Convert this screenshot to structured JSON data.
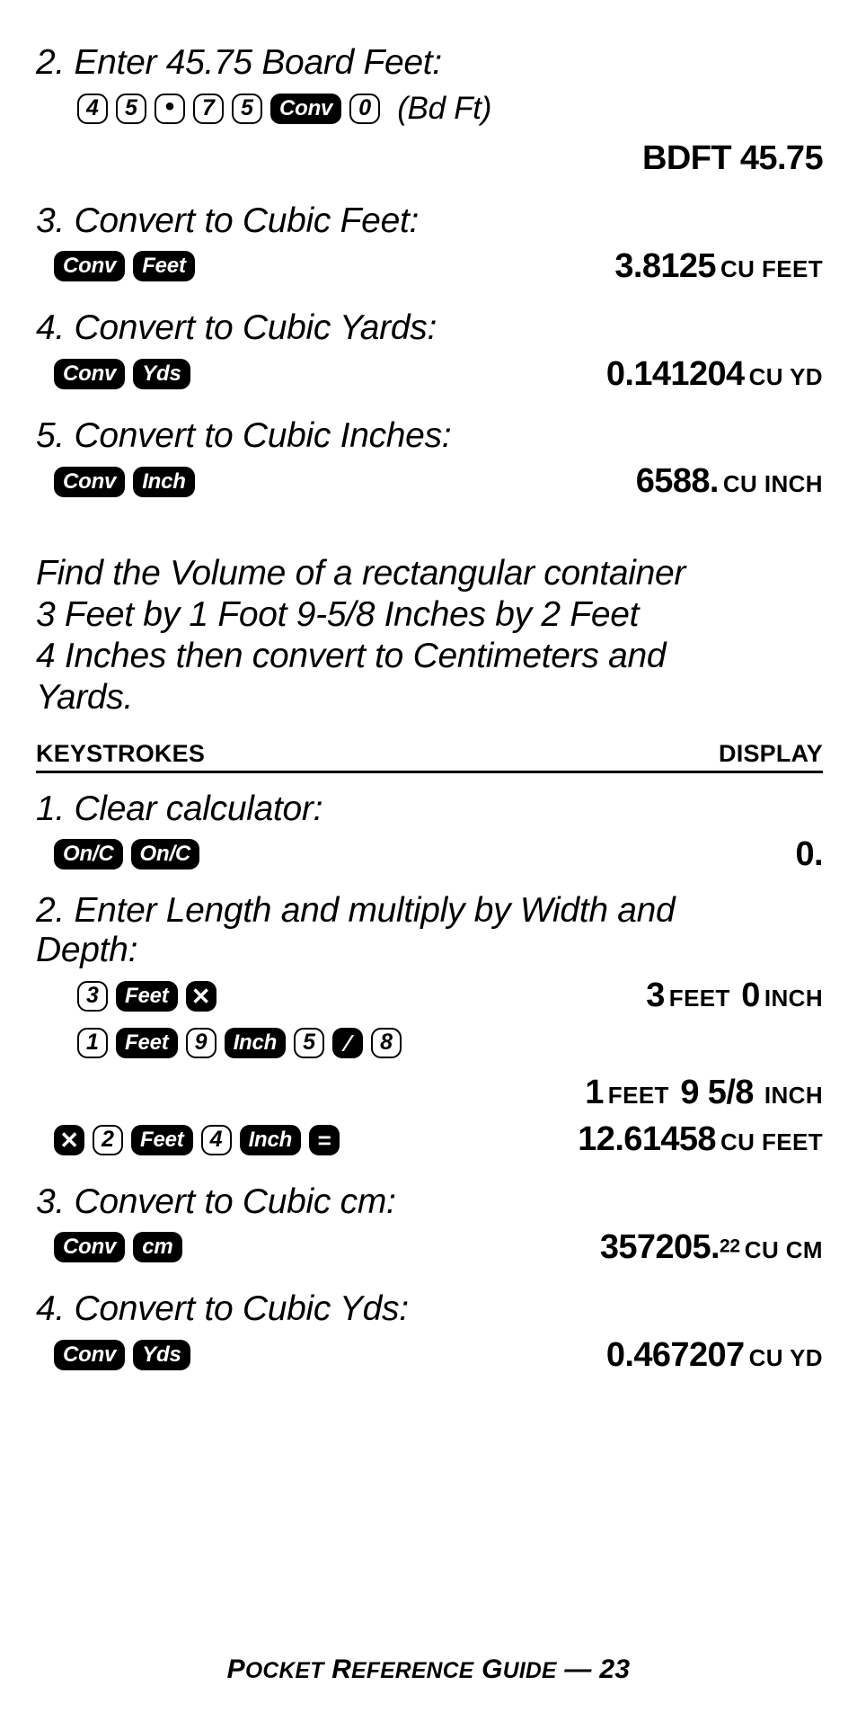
{
  "page": {
    "footer_prefix": "Pocket Reference Guide",
    "footer_dash": "—",
    "footer_page": "23"
  },
  "example_one": {
    "steps": [
      {
        "title": "2. Enter 45.75 Board Feet:",
        "keys": [
          {
            "type": "num",
            "label": "4"
          },
          {
            "type": "num",
            "label": "5"
          },
          {
            "type": "dot",
            "label": "•"
          },
          {
            "type": "num",
            "label": "7"
          },
          {
            "type": "num",
            "label": "5"
          },
          {
            "type": "fn",
            "label": "Conv"
          },
          {
            "type": "num",
            "label": "0"
          }
        ],
        "key_note": "(Bd Ft)",
        "display_value": "BDFT 45.75",
        "display_unit": ""
      },
      {
        "title": "3. Convert to Cubic Feet:",
        "keys": [
          {
            "type": "fn",
            "label": "Conv"
          },
          {
            "type": "fn",
            "label": "Feet"
          }
        ],
        "key_note": "",
        "display_value": "3.8125",
        "display_unit": "CU FEET"
      },
      {
        "title": "4. Convert to Cubic Yards:",
        "keys": [
          {
            "type": "fn",
            "label": "Conv"
          },
          {
            "type": "fn",
            "label": "Yds"
          }
        ],
        "key_note": "",
        "display_value": "0.141204",
        "display_unit": "CU YD"
      },
      {
        "title": "5. Convert to Cubic Inches:",
        "keys": [
          {
            "type": "fn",
            "label": "Conv"
          },
          {
            "type": "fn",
            "label": "Inch"
          }
        ],
        "key_note": "",
        "display_value": "6588.",
        "display_unit": "CU INCH"
      }
    ]
  },
  "problem": {
    "lines": [
      "Find the Volume of a rectangular container",
      "3 Feet by 1 Foot 9-5/8 Inches by 2 Feet",
      "4 Inches then convert to Centimeters and",
      "Yards."
    ]
  },
  "table_header": {
    "keystrokes": "KEYSTROKES",
    "display": "DISPLAY"
  },
  "example_two": {
    "step1": {
      "title": "1. Clear calculator:",
      "keys": [
        {
          "type": "fn",
          "label": "On/C"
        },
        {
          "type": "fn",
          "label": "On/C"
        }
      ],
      "display_value": "0.",
      "display_unit": ""
    },
    "step2": {
      "title_line1": "2. Enter Length and multiply by Width and",
      "title_line2": "Depth:",
      "row_a": {
        "keys": [
          {
            "type": "num",
            "label": "3"
          },
          {
            "type": "fn",
            "label": "Feet"
          },
          {
            "type": "fnsq",
            "label": "✕"
          }
        ],
        "display": [
          {
            "kind": "val",
            "text": "3"
          },
          {
            "kind": "unit",
            "text": "FEET"
          },
          {
            "kind": "val",
            "text": "0"
          },
          {
            "kind": "unit",
            "text": "INCH"
          }
        ]
      },
      "row_b": {
        "keys": [
          {
            "type": "num",
            "label": "1"
          },
          {
            "type": "fn",
            "label": "Feet"
          },
          {
            "type": "num",
            "label": "9"
          },
          {
            "type": "fn",
            "label": "Inch"
          },
          {
            "type": "num",
            "label": "5"
          },
          {
            "type": "fnsq",
            "label": "∕"
          },
          {
            "type": "num",
            "label": "8"
          }
        ],
        "display": [
          {
            "kind": "val",
            "text": "1"
          },
          {
            "kind": "unit",
            "text": "FEET"
          },
          {
            "kind": "val",
            "text": "9 5/8"
          },
          {
            "kind": "unit",
            "text": "INCH"
          }
        ]
      },
      "row_c": {
        "keys": [
          {
            "type": "fnsq",
            "label": "✕"
          },
          {
            "type": "num",
            "label": "2"
          },
          {
            "type": "fn",
            "label": "Feet"
          },
          {
            "type": "num",
            "label": "4"
          },
          {
            "type": "fn",
            "label": "Inch"
          },
          {
            "type": "fnsq",
            "label": "="
          }
        ],
        "display": [
          {
            "kind": "val",
            "text": "12.61458"
          },
          {
            "kind": "unit",
            "text": "CU FEET"
          }
        ]
      }
    },
    "step3": {
      "title": "3. Convert to Cubic cm:",
      "keys": [
        {
          "type": "fn",
          "label": "Conv"
        },
        {
          "type": "fn",
          "label": "cm"
        }
      ],
      "display_value": "357205.",
      "display_sup": "22",
      "display_unit": "CU CM"
    },
    "step4": {
      "title": "4. Convert to Cubic Yds:",
      "keys": [
        {
          "type": "fn",
          "label": "Conv"
        },
        {
          "type": "fn",
          "label": "Yds"
        }
      ],
      "display_value": "0.467207",
      "display_unit": "CU YD"
    }
  }
}
